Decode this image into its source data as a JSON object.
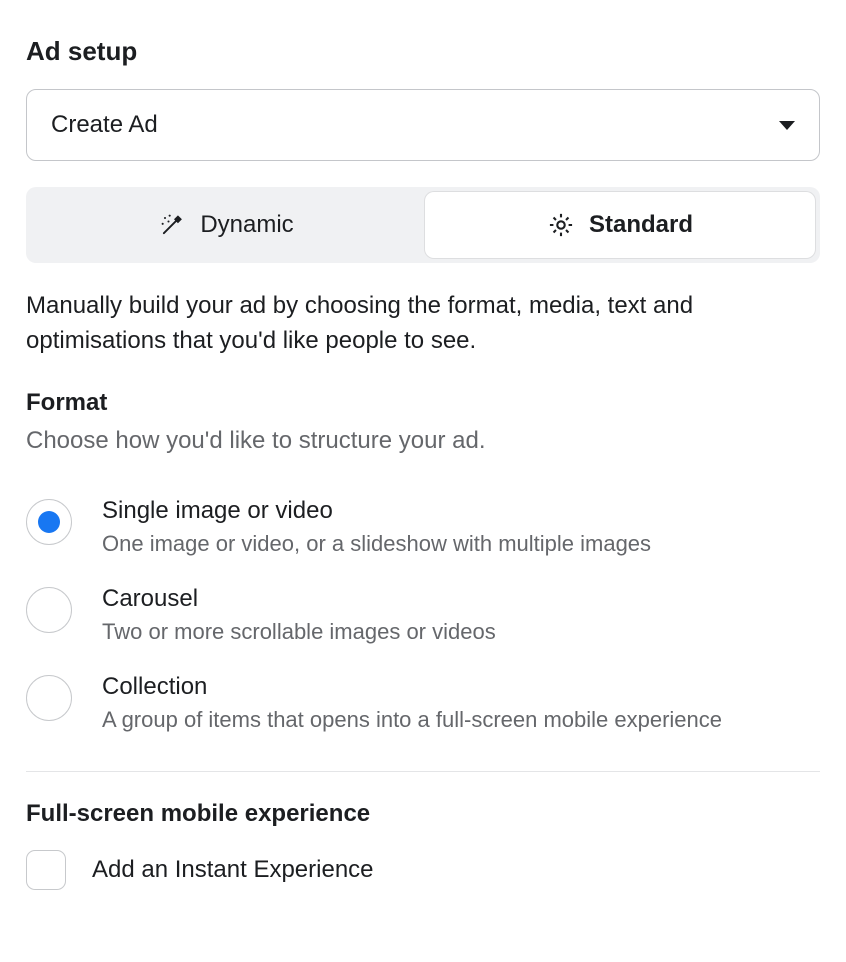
{
  "header": {
    "title": "Ad setup"
  },
  "dropdown": {
    "selected_label": "Create Ad"
  },
  "segmented": {
    "dynamic_label": "Dynamic",
    "standard_label": "Standard",
    "active": "standard"
  },
  "description": "Manually build your ad by choosing the format, media, text and optimisations that you'd like people to see.",
  "format": {
    "title": "Format",
    "hint": "Choose how you'd like to structure your ad.",
    "options": [
      {
        "title": "Single image or video",
        "desc": "One image or video, or a slideshow with multiple images",
        "selected": true
      },
      {
        "title": "Carousel",
        "desc": "Two or more scrollable images or videos",
        "selected": false
      },
      {
        "title": "Collection",
        "desc": "A group of items that opens into a full-screen mobile experience",
        "selected": false
      }
    ]
  },
  "fullscreen": {
    "title": "Full-screen mobile experience",
    "checkbox_label": "Add an Instant Experience",
    "checked": false
  }
}
